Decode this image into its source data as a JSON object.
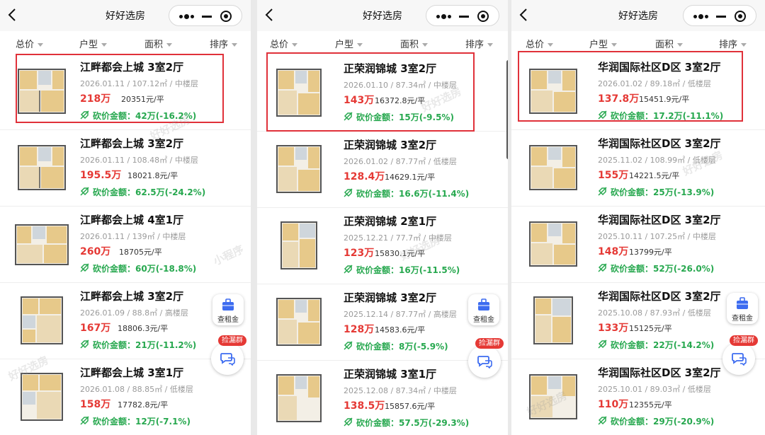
{
  "panels": [
    {
      "title": "好好选房",
      "filters": [
        "总价",
        "户型",
        "面积",
        "排序"
      ],
      "listings": [
        {
          "title": "江畔都会上城 3室2厅",
          "meta": "2026.01.11 / 107.12㎡ / 中楼层",
          "price": "218万",
          "unit_price": "20351元/平",
          "cut": "砍价金额：42万(-16.2%)"
        },
        {
          "title": "江畔都会上城 3室2厅",
          "meta": "2026.01.11 / 108.48㎡ / 中楼层",
          "price": "195.5万",
          "unit_price": "18021.8元/平",
          "cut": "砍价金额：62.5万(-24.2%)"
        },
        {
          "title": "江畔都会上城 4室1厅",
          "meta": "2026.01.11 / 139㎡ / 中楼层",
          "price": "260万",
          "unit_price": "18705元/平",
          "cut": "砍价金额：60万(-18.8%)"
        },
        {
          "title": "江畔都会上城 3室2厅",
          "meta": "2026.01.09 / 88.8㎡ / 高楼层",
          "price": "167万",
          "unit_price": "18806.3元/平",
          "cut": "砍价金额：21万(-11.2%)"
        },
        {
          "title": "江畔都会上城 3室1厅",
          "meta": "2026.01.08 / 88.85㎡ / 低楼层",
          "price": "158万",
          "unit_price": "17782.8元/平",
          "cut": "砍价金额：12万(-7.1%)"
        }
      ]
    },
    {
      "title": "好好选房",
      "filters": [
        "总价",
        "户型",
        "面积",
        "排序"
      ],
      "listings": [
        {
          "title": "正荣润锦城 3室2厅",
          "meta": "2026.01.10 / 87.34㎡ / 中楼层",
          "price": "143万",
          "unit_price": "16372.8元/平",
          "cut": "砍价金额：15万(-9.5%)"
        },
        {
          "title": "正荣润锦城 3室2厅",
          "meta": "2026.01.02 / 87.77㎡ / 低楼层",
          "price": "128.4万",
          "unit_price": "14629.1元/平",
          "cut": "砍价金额：16.6万(-11.4%)"
        },
        {
          "title": "正荣润锦城 2室1厅",
          "meta": "2025.12.21 / 77.7㎡ / 中楼层",
          "price": "123万",
          "unit_price": "15830.1元/平",
          "cut": "砍价金额：16万(-11.5%)"
        },
        {
          "title": "正荣润锦城 3室2厅",
          "meta": "2025.12.14 / 87.77㎡ / 高楼层",
          "price": "128万",
          "unit_price": "14583.6元/平",
          "cut": "砍价金额：8万(-5.9%)"
        },
        {
          "title": "正荣润锦城 3室1厅",
          "meta": "2025.12.08 / 87.34㎡ / 中楼层",
          "price": "138.5万",
          "unit_price": "15857.6元/平",
          "cut": "砍价金额：57.5万(-29.3%)"
        }
      ]
    },
    {
      "title": "好好选房",
      "filters": [
        "总价",
        "户型",
        "面积",
        "排序"
      ],
      "listings": [
        {
          "title": "华润国际社区D区 3室2厅",
          "meta": "2026.01.02 / 89.18㎡ / 低楼层",
          "price": "137.8万",
          "unit_price": "15451.9元/平",
          "cut": "砍价金额：17.2万(-11.1%)"
        },
        {
          "title": "华润国际社区D区 3室2厅",
          "meta": "2025.11.02 / 108.99㎡ / 低楼层",
          "price": "155万",
          "unit_price": "14221.5元/平",
          "cut": "砍价金额：25万(-13.9%)"
        },
        {
          "title": "华润国际社区D区 3室2厅",
          "meta": "2025.10.11 / 107.25㎡ / 中楼层",
          "price": "148万",
          "unit_price": "13799元/平",
          "cut": "砍价金额：52万(-26.0%)"
        },
        {
          "title": "华润国际社区D区 3室2厅",
          "meta": "2025.10.08 / 87.93㎡ / 低楼层",
          "price": "133万",
          "unit_price": "15125元/平",
          "cut": "砍价金额：22万(-14.2%)"
        },
        {
          "title": "华润国际社区D区 3室2厅",
          "meta": "2025.10.01 / 89.03㎡ / 低楼层",
          "price": "110万",
          "unit_price": "12355元/平",
          "cut": "砍价金额：29万(-20.9%)"
        }
      ]
    }
  ],
  "fab": {
    "rent_label": "查租金",
    "group_badge": "捡漏群"
  },
  "watermark": [
    "好好选房",
    "小程序"
  ],
  "colors": {
    "price": "#e53935",
    "cut": "#27a84f",
    "highlight": "#e0313a",
    "fab_blue": "#3d6cf0"
  },
  "icons": {
    "back": "chevron-left-icon",
    "menu": "more-dots-icon",
    "minimize": "minimize-icon",
    "close": "target-circle-icon",
    "rent": "briefcase-icon",
    "group": "chat-bubbles-icon",
    "cut": "price-tag-icon"
  }
}
